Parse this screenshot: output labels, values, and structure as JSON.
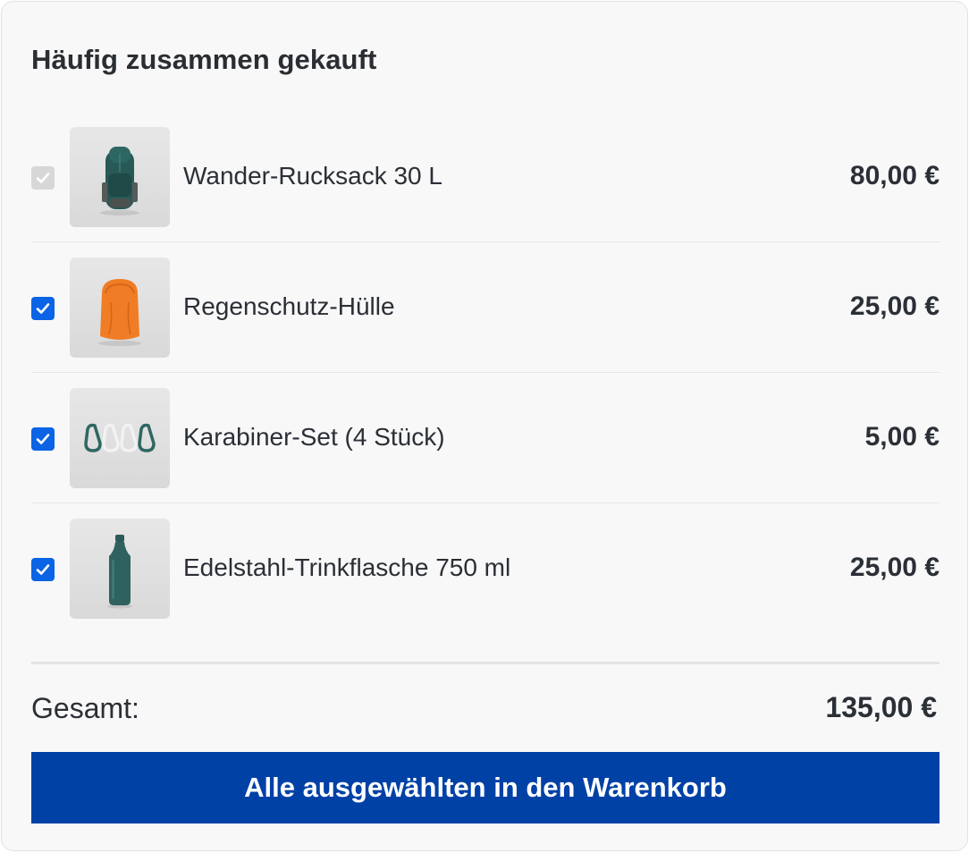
{
  "widget": {
    "title": "Häufig zusammen gekauft",
    "items": [
      {
        "name": "Wander-Rucksack 30 L",
        "price": "80,00 €",
        "checked": true,
        "disabled": true,
        "icon": "backpack-icon"
      },
      {
        "name": "Regenschutz-Hülle",
        "price": "25,00 €",
        "checked": true,
        "disabled": false,
        "icon": "rain-cover-icon"
      },
      {
        "name": "Karabiner-Set (4 Stück)",
        "price": "5,00 €",
        "checked": true,
        "disabled": false,
        "icon": "carabiner-icon"
      },
      {
        "name": "Edelstahl-Trinkflasche 750 ml",
        "price": "25,00 €",
        "checked": true,
        "disabled": false,
        "icon": "bottle-icon"
      }
    ],
    "total_label": "Gesamt:",
    "total_value": "135,00 €",
    "cta_label": "Alle ausgewählten in den Warenkorb"
  },
  "colors": {
    "accent_checkbox": "#0b63e5",
    "cta_background": "#0041a6",
    "card_background": "#f8f8f8"
  }
}
